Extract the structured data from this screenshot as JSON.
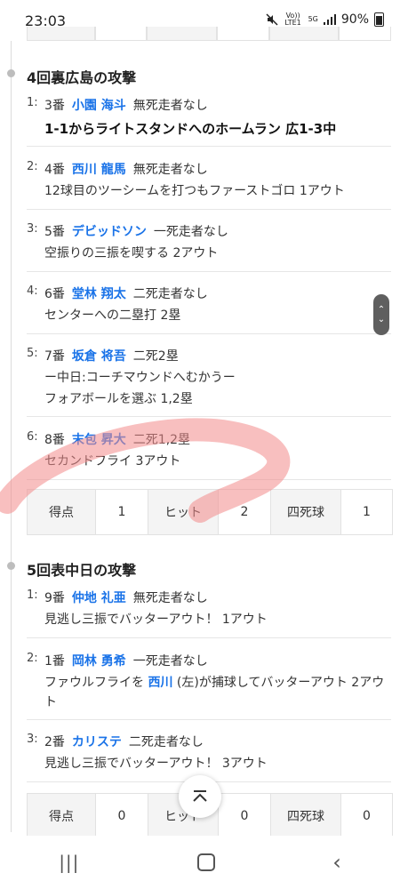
{
  "status_bar": {
    "time": "23:03",
    "network_1": "Vo)) LTE1",
    "network_2": "5G",
    "battery": "90%"
  },
  "sections": [
    {
      "title": "4回裏広島の攻撃",
      "plays": [
        {
          "num": "1:",
          "order": "3番",
          "player": "小園 海斗",
          "situation": "無死走者なし",
          "desc": "1-1からライトスタンドへのホームラン 広1-3中"
        },
        {
          "num": "2:",
          "order": "4番",
          "player": "西川 龍馬",
          "situation": "無死走者なし",
          "desc": "12球目のツーシームを打つもファーストゴロ 1アウト"
        },
        {
          "num": "3:",
          "order": "5番",
          "player": "デビッドソン",
          "situation": "一死走者なし",
          "desc": "空振りの三振を喫する 2アウト"
        },
        {
          "num": "4:",
          "order": "6番",
          "player": "堂林 翔太",
          "situation": "二死走者なし",
          "desc": "センターへの二塁打 2塁"
        },
        {
          "num": "5:",
          "order": "7番",
          "player": "坂倉 将吾",
          "situation": "二死2塁",
          "desc_line1": "ー中日:コーチマウンドへむかうー",
          "desc_line2": "フォアボールを選ぶ 1,2塁"
        },
        {
          "num": "6:",
          "order": "8番",
          "player": "末包 昇大",
          "situation": "二死1,2塁",
          "desc": "セカンドフライ 3アウト"
        }
      ],
      "stats": {
        "runs_label": "得点",
        "runs": "1",
        "hits_label": "ヒット",
        "hits": "2",
        "walks_label": "四死球",
        "walks": "1"
      }
    },
    {
      "title": "5回表中日の攻撃",
      "plays": [
        {
          "num": "1:",
          "order": "9番",
          "player": "仲地 礼亜",
          "situation": "無死走者なし",
          "desc": "見逃し三振でバッターアウト！ 1アウト"
        },
        {
          "num": "2:",
          "order": "1番",
          "player": "岡林 勇希",
          "situation": "一死走者なし",
          "desc_pre": "ファウルフライを ",
          "desc_player": "西川",
          "desc_post": " (左)が捕球してバッターアウト 2アウト"
        },
        {
          "num": "3:",
          "order": "2番",
          "player": "カリステ",
          "situation": "二死走者なし",
          "desc": "見逃し三振でバッターアウト！ 3アウト"
        }
      ],
      "stats": {
        "runs_label": "得点",
        "runs": "0",
        "hits_label": "ヒット",
        "hits": "0",
        "walks_label": "四死球",
        "walks": "0"
      }
    }
  ],
  "nav": {
    "recent": "|||",
    "back": "‹"
  },
  "icons": [
    "mute-icon",
    "signal-icon",
    "battery-icon",
    "scroll-top-icon",
    "scroll-handle-icon"
  ],
  "colors": {
    "player_link": "#1a73e8",
    "swipe_overlay": "#f28b8b"
  }
}
